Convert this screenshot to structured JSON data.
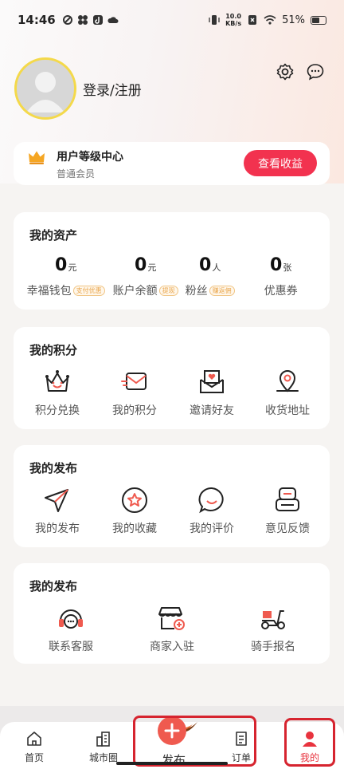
{
  "status_bar": {
    "time": "14:46",
    "net_speed_value": "10.0",
    "net_speed_unit": "KB/s",
    "battery": "51%",
    "battery_level": 0.51
  },
  "profile": {
    "login_label": "登录/注册",
    "settings_icon": "gear-icon",
    "message_icon": "chat-bubble-icon"
  },
  "level_card": {
    "title": "用户等级中心",
    "subtitle": "普通会员",
    "button": "查看收益",
    "icon": "crown-icon",
    "accent": "#f2324f"
  },
  "assets": {
    "title": "我的资产",
    "items": [
      {
        "value": "0",
        "unit": "元",
        "label": "幸福钱包",
        "tag": "支付优惠"
      },
      {
        "value": "0",
        "unit": "元",
        "label": "账户余额",
        "tag": "提现"
      },
      {
        "value": "0",
        "unit": "人",
        "label": "粉丝",
        "tag": "赚返佣"
      },
      {
        "value": "0",
        "unit": "张",
        "label": "优惠券",
        "tag": ""
      }
    ]
  },
  "points": {
    "title": "我的积分",
    "items": [
      {
        "label": "积分兑换",
        "icon": "crown-face-icon"
      },
      {
        "label": "我的积分",
        "icon": "mail-fast-icon"
      },
      {
        "label": "邀请好友",
        "icon": "heart-envelope-icon"
      },
      {
        "label": "收货地址",
        "icon": "location-pin-icon"
      }
    ]
  },
  "publish": {
    "title": "我的发布",
    "items": [
      {
        "label": "我的发布",
        "icon": "paper-plane-icon"
      },
      {
        "label": "我的收藏",
        "icon": "star-circle-icon"
      },
      {
        "label": "我的评价",
        "icon": "smile-bubble-icon"
      },
      {
        "label": "意见反馈",
        "icon": "feedback-box-icon"
      }
    ]
  },
  "service": {
    "title": "我的发布",
    "items": [
      {
        "label": "联系客服",
        "icon": "headset-icon"
      },
      {
        "label": "商家入驻",
        "icon": "shop-plus-icon"
      },
      {
        "label": "骑手报名",
        "icon": "scooter-icon"
      }
    ]
  },
  "tabbar": {
    "items": [
      {
        "label": "首页",
        "icon": "home-icon"
      },
      {
        "label": "城市圈",
        "icon": "city-buildings-icon"
      },
      {
        "label": "发布",
        "icon": "plus-icon"
      },
      {
        "label": "订单",
        "icon": "order-list-icon"
      },
      {
        "label": "我的",
        "icon": "person-icon"
      }
    ],
    "active": "我的",
    "active_color": "#e8333e"
  }
}
